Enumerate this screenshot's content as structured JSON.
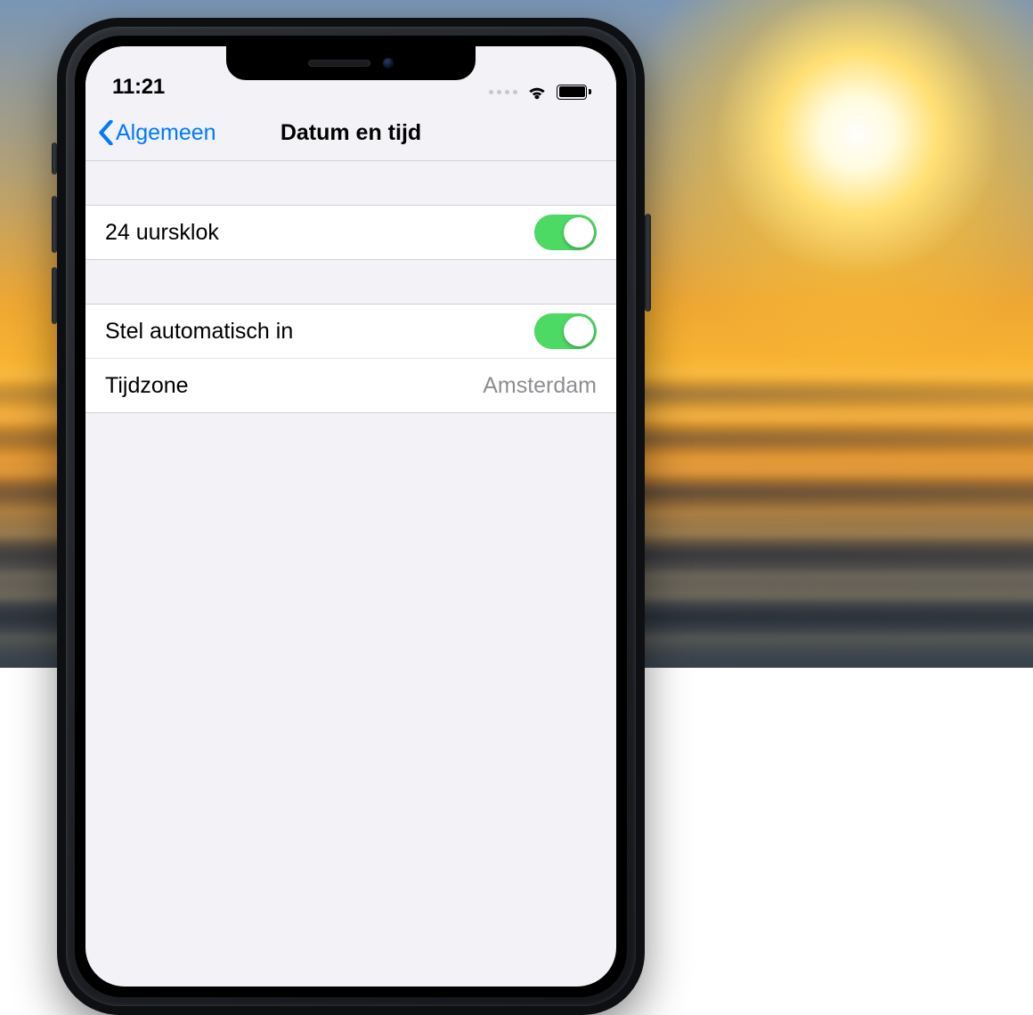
{
  "statusbar": {
    "time": "11:21"
  },
  "navbar": {
    "back_label": "Algemeen",
    "title": "Datum en tijd"
  },
  "settings": {
    "clock24": {
      "label": "24 uursklok",
      "on": true
    },
    "auto": {
      "label": "Stel automatisch in",
      "on": true
    },
    "timezone": {
      "label": "Tijdzone",
      "value": "Amsterdam"
    }
  },
  "colors": {
    "ios_blue": "#007aff",
    "ios_green": "#4cd964",
    "ios_gray_bg": "#f2f2f7",
    "ios_separator": "#d1d1d6"
  }
}
